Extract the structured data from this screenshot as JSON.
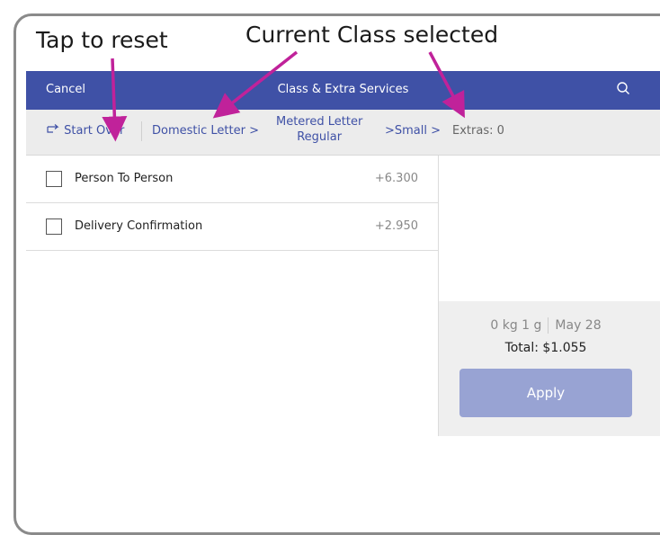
{
  "annotations": {
    "reset": "Tap to reset",
    "current": "Current Class selected"
  },
  "header": {
    "cancel": "Cancel",
    "title": "Class & Extra Services",
    "search_icon": "search-icon"
  },
  "breadcrumb": {
    "start_over": "Start Over",
    "domestic": "Domestic Letter >",
    "metered_line1": "Metered Letter",
    "metered_line2": "Regular",
    "small": ">Small >",
    "extras": "Extras: 0"
  },
  "extras": [
    {
      "label": "Person To Person",
      "price": "+6.300",
      "checked": false
    },
    {
      "label": "Delivery Confirmation",
      "price": "+2.950",
      "checked": false
    }
  ],
  "summary": {
    "weight": "0 kg 1 g",
    "date": "May 28",
    "total": "Total: $1.055",
    "apply": "Apply"
  },
  "colors": {
    "header": "#3f51a6",
    "link": "#3f51a6",
    "arrow": "#c0229a",
    "apply_disabled": "#98a3d3"
  }
}
